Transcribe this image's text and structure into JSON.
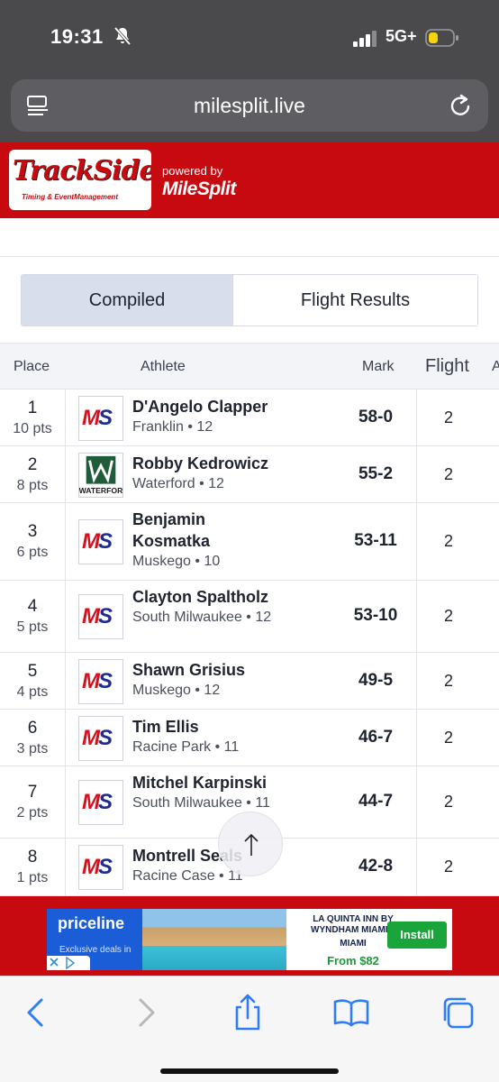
{
  "status_bar": {
    "time": "19:31",
    "network": "5G+"
  },
  "browser": {
    "url": "milesplit.live"
  },
  "header": {
    "logo_title": "TrackSide",
    "logo_subtitle": "Timing & EventManagement",
    "powered_by": "powered by",
    "brand": "MileSplit"
  },
  "tabs": [
    {
      "label": "Compiled",
      "active": true
    },
    {
      "label": "Flight Results",
      "active": false
    }
  ],
  "table": {
    "headers": {
      "place": "Place",
      "athlete": "Athlete",
      "mark": "Mark",
      "flight": "Flight",
      "extra": "A"
    },
    "rows": [
      {
        "place": "1",
        "pts": "10 pts",
        "name": "D'Angelo Clapper",
        "school": "Franklin • 12",
        "mark": "58-0",
        "flight": "2",
        "logo": "ms-logo"
      },
      {
        "place": "2",
        "pts": "8 pts",
        "name": "Robby Kedrowicz",
        "school": "Waterford • 12",
        "mark": "55-2",
        "flight": "2",
        "logo": "waterford-logo",
        "logo_text": "WATERFOR"
      },
      {
        "place": "3",
        "pts": "6 pts",
        "name": "Benjamin Kosmatka",
        "school": "Muskego • 10",
        "mark": "53-11",
        "flight": "2",
        "logo": "ms-logo"
      },
      {
        "place": "4",
        "pts": "5 pts",
        "name": "Clayton Spaltholz",
        "school": "South Milwaukee • 12",
        "mark": "53-10",
        "flight": "2",
        "logo": "ms-logo"
      },
      {
        "place": "5",
        "pts": "4 pts",
        "name": "Shawn Grisius",
        "school": "Muskego • 12",
        "mark": "49-5",
        "flight": "2",
        "logo": "ms-logo"
      },
      {
        "place": "6",
        "pts": "3 pts",
        "name": "Tim Ellis",
        "school": "Racine Park • 11",
        "mark": "46-7",
        "flight": "2",
        "logo": "ms-logo"
      },
      {
        "place": "7",
        "pts": "2 pts",
        "name": "Mitchel Karpinski",
        "school": "South Milwaukee • 11",
        "mark": "44-7",
        "flight": "2",
        "logo": "ms-logo"
      },
      {
        "place": "8",
        "pts": "1 pts",
        "name": "Montrell Seals",
        "school": "Racine Case • 11",
        "mark": "42-8",
        "flight": "2",
        "logo": "ms-logo"
      }
    ]
  },
  "ad": {
    "brand": "priceline",
    "tagline": "Exclusive deals in the app",
    "hotel": "LA QUINTA INN BY WYNDHAM MIAMI...",
    "city": "MIAMI",
    "price": "From $82",
    "cta": "Install"
  },
  "colors": {
    "banner_red": "#c70a10",
    "active_tab": "#d9deec",
    "ios_blue": "#2f7cf6",
    "install_green": "#19a53a"
  }
}
